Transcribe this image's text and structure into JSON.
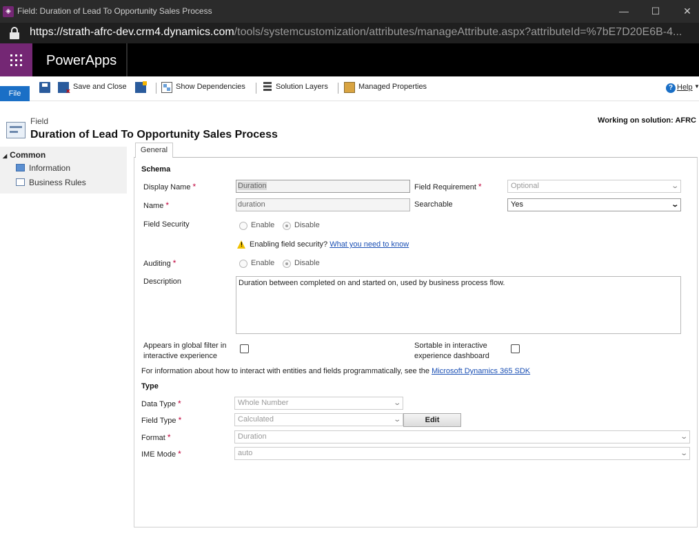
{
  "window": {
    "title": "Field: Duration of Lead To Opportunity Sales Process",
    "url_host": "https://strath-afrc-dev.crm4.dynamics.com",
    "url_path": "/tools/systemcustomization/attributes/manageAttribute.aspx?attributeId=%7bE7D20E6B-4..."
  },
  "header": {
    "app_name": "PowerApps"
  },
  "ribbon": {
    "file": "File",
    "save_and_close": "Save and Close",
    "show_dependencies": "Show Dependencies",
    "solution_layers": "Solution Layers",
    "managed_properties": "Managed Properties",
    "help": "Help"
  },
  "entity": {
    "type": "Field",
    "title": "Duration of Lead To Opportunity Sales Process",
    "working_on": "Working on solution: AFRC"
  },
  "nav": {
    "group": "Common",
    "items": [
      "Information",
      "Business Rules"
    ]
  },
  "tabs": [
    "General"
  ],
  "schema": {
    "section": "Schema",
    "display_name_label": "Display Name",
    "display_name_value": "Duration",
    "name_label": "Name",
    "name_value": "duration",
    "field_requirement_label": "Field Requirement",
    "field_requirement_value": "Optional",
    "searchable_label": "Searchable",
    "searchable_value": "Yes",
    "field_security_label": "Field Security",
    "enable": "Enable",
    "disable": "Disable",
    "security_warning": "Enabling field security?",
    "security_link": "What you need to know",
    "auditing_label": "Auditing",
    "description_label": "Description",
    "description_value": "Duration between completed on and started on, used by business process flow.",
    "global_filter_label_1": "Appears in global filter in",
    "global_filter_label_2": "interactive experience",
    "sortable_label_1": "Sortable in interactive",
    "sortable_label_2": "experience dashboard",
    "sdk_text": "For information about how to interact with entities and fields programmatically, see the",
    "sdk_link": "Microsoft Dynamics 365 SDK"
  },
  "type": {
    "section": "Type",
    "data_type_label": "Data Type",
    "data_type_value": "Whole Number",
    "field_type_label": "Field Type",
    "field_type_value": "Calculated",
    "edit_button": "Edit",
    "format_label": "Format",
    "format_value": "Duration",
    "ime_mode_label": "IME Mode",
    "ime_mode_value": "auto"
  },
  "colors": {
    "accent_purple": "#742774",
    "file_blue": "#1a6fc6",
    "required_red": "#c0003a",
    "link_blue": "#1a4fb4"
  }
}
